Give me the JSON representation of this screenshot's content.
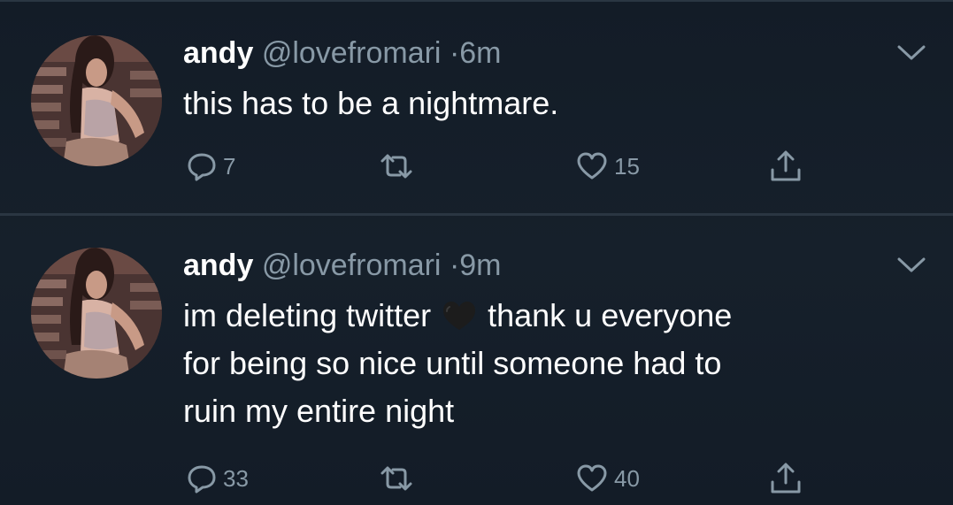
{
  "tweets": [
    {
      "name": "andy",
      "handle": "@lovefromari",
      "separator": "·",
      "time": "6m",
      "text_lines": [
        "this has to be a nightmare."
      ],
      "replies": "7",
      "retweets": "",
      "likes": "15",
      "icons": {
        "reply": "reply-icon",
        "retweet": "retweet-icon",
        "like": "heart-icon",
        "share": "share-icon",
        "menu": "chevron-down-icon"
      }
    },
    {
      "name": "andy",
      "handle": "@lovefromari",
      "separator": "·",
      "time": "9m",
      "text_lines": [
        "im deleting twitter",
        "thank u everyone",
        "for being so nice until someone had to",
        "ruin my entire night"
      ],
      "emoji": "black-heart-emoji",
      "replies": "33",
      "retweets": "",
      "likes": "40",
      "icons": {
        "reply": "reply-icon",
        "retweet": "retweet-icon",
        "like": "heart-icon",
        "share": "share-icon",
        "menu": "chevron-down-icon"
      }
    }
  ],
  "colors": {
    "background": "#15202b",
    "text_primary": "#ffffff",
    "text_secondary": "#8899a6",
    "divider": "#2a3642"
  }
}
